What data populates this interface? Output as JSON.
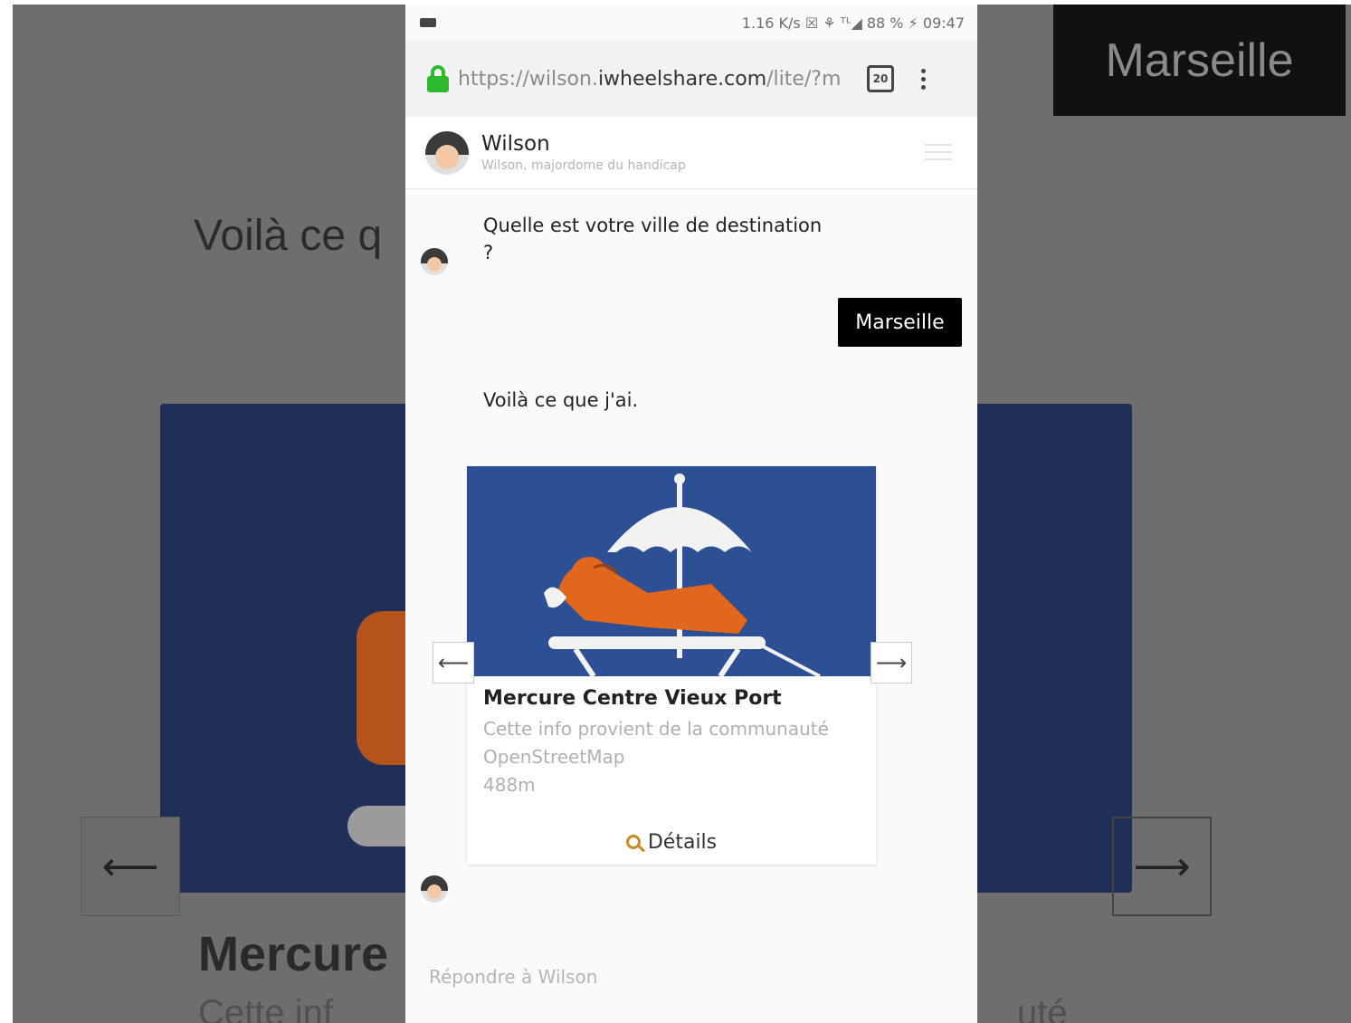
{
  "background": {
    "marseille_text": "Marseille",
    "voila_text": "Voilà ce q",
    "mercure_text": "Mercure",
    "cette_text": "Cette inf",
    "cette_right_text": "uté",
    "left_arrow": "⟵",
    "right_arrow": "⟶"
  },
  "statusbar": {
    "right": "1.16 K/s  ☒ ⚘ ᵀᴸ◢ 88 % ⚡ 09:47"
  },
  "browser": {
    "url_prefix": "https://wilson.",
    "url_host": "iwheelshare.com",
    "url_suffix": "/lite/?m",
    "tab_count": "20"
  },
  "chat_header": {
    "name": "Wilson",
    "subtitle": "Wilson, majordome du handicap"
  },
  "messages": {
    "bot_question": "Quelle est votre ville de destination ?",
    "user_answer": "Marseille",
    "bot_result_intro": "Voilà ce que j'ai."
  },
  "card": {
    "title": "Mercure Centre Vieux Port",
    "desc_line1": "Cette info provient de la communauté",
    "desc_line2": "OpenStreetMap",
    "distance": "488m",
    "details_label": "Détails",
    "prev_arrow": "⟵",
    "next_arrow": "⟶"
  },
  "reply": {
    "placeholder": "Répondre à Wilson"
  },
  "colors": {
    "card_image_bg": "#2d4f93",
    "accent_orange": "#e0671b",
    "lock_green": "#2eb82e"
  }
}
